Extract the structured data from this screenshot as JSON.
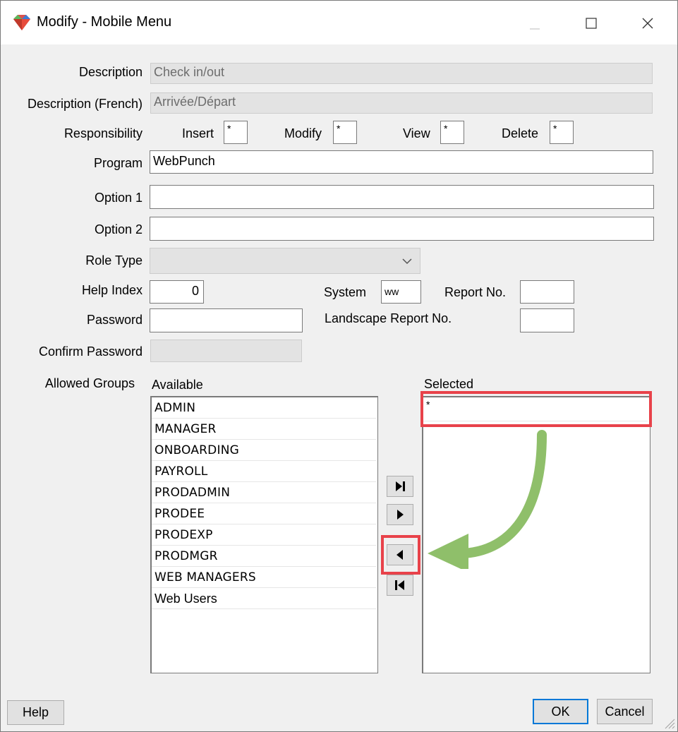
{
  "window": {
    "title": "Modify - Mobile Menu",
    "icon": "app-gem-icon",
    "controls": [
      "minimize-icon",
      "maximize-icon",
      "close-icon"
    ]
  },
  "form": {
    "description_label": "Description",
    "description_value": "Check in/out",
    "description_fr_label": "Description (French)",
    "description_fr_value": "Arrivée/Départ",
    "responsibility_label": "Responsibility",
    "insert_label": "Insert",
    "insert_value": "*",
    "modify_label": "Modify",
    "modify_value": "*",
    "view_label": "View",
    "view_value": "*",
    "delete_label": "Delete",
    "delete_value": "*",
    "program_label": "Program",
    "program_value": "WebPunch",
    "option1_label": "Option 1",
    "option1_value": "",
    "option2_label": "Option 2",
    "option2_value": "",
    "role_type_label": "Role Type",
    "role_type_value": "",
    "help_index_label": "Help Index",
    "help_index_value": "0",
    "system_label": "System",
    "system_value": "ww",
    "report_no_label": "Report No.",
    "report_no_value": "",
    "password_label": "Password",
    "password_value": "",
    "landscape_label": "Landscape Report No.",
    "landscape_value": "",
    "confirm_password_label": "Confirm Password",
    "confirm_password_value": ""
  },
  "groups": {
    "label": "Allowed Groups",
    "available_label": "Available",
    "selected_label": "Selected",
    "available": [
      "ADMIN",
      "MANAGER",
      "ONBOARDING",
      "PAYROLL",
      "PRODADMIN",
      "PRODEE",
      "PRODEXP",
      "PRODMGR",
      "WEB MANAGERS",
      "Web Users"
    ],
    "selected": [
      "*"
    ],
    "move_buttons": [
      "move-all-right-icon",
      "move-right-icon",
      "move-left-icon",
      "move-all-left-icon"
    ]
  },
  "annotations": {
    "highlight_color": "#e8424a",
    "arrow_color": "#8fbf6a"
  },
  "footer": {
    "help_label": "Help",
    "ok_label": "OK",
    "cancel_label": "Cancel"
  }
}
